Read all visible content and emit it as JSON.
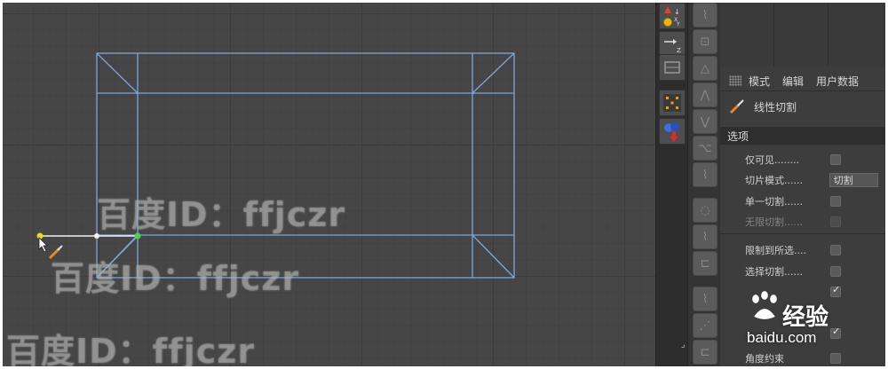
{
  "viewport": {
    "watermark_text": "百度ID：ffjczr"
  },
  "panel": {
    "menu": [
      "模式",
      "编辑",
      "用户数据"
    ],
    "tool_name": "线性切割",
    "section_title": "选项",
    "options": [
      {
        "label": "仅可见........",
        "type": "checkbox",
        "checked": false,
        "enabled": true
      },
      {
        "label": "切片模式......",
        "type": "dropdown",
        "value": "切割",
        "enabled": true
      },
      {
        "label": "单一切割......",
        "type": "checkbox",
        "checked": false,
        "enabled": true
      },
      {
        "label": "无限切割......",
        "type": "checkbox",
        "checked": false,
        "enabled": false
      },
      {
        "label": "限制到所选....",
        "type": "checkbox",
        "checked": false,
        "enabled": true
      },
      {
        "label": "选择切割......",
        "type": "checkbox",
        "checked": false,
        "enabled": true
      },
      {
        "label": "",
        "type": "checkbox",
        "checked": true,
        "enabled": true
      },
      {
        "label": "",
        "type": "checkbox",
        "checked": true,
        "enabled": true
      },
      {
        "label": "角度约束",
        "type": "checkbox",
        "checked": false,
        "enabled": true
      }
    ]
  },
  "overlay": {
    "brand": "经验",
    "url": "baidu.com"
  },
  "colors": {
    "wire": "#7aa7dc",
    "cut_line": "#f2f2f2",
    "point_start": "#e8d820",
    "point_end": "#4ed24e",
    "panel_bg": "#3d3d3d"
  }
}
